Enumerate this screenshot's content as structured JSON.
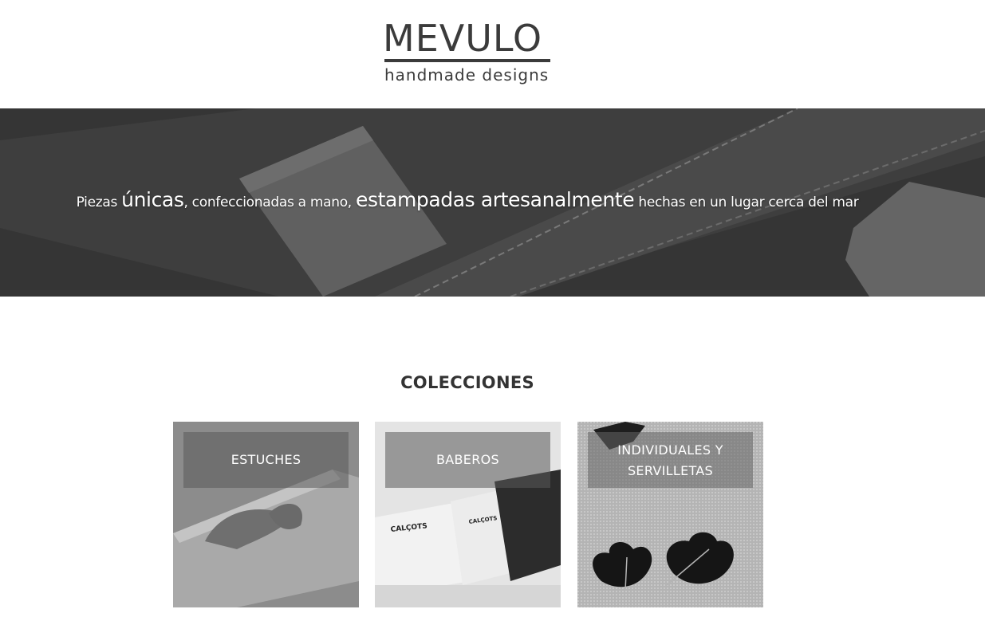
{
  "header": {
    "logo_word": "MEVULO",
    "logo_sub": "handmade  designs"
  },
  "hero": {
    "part1": "Piezas ",
    "part2": "únicas",
    "part3": ", confeccionadas a mano, ",
    "part4": "estampadas artesanalmente",
    "part5": " hechas en un lugar cerca del mar"
  },
  "collections": {
    "title": "COLECCIONES",
    "items": [
      {
        "label": "ESTUCHES"
      },
      {
        "label": "BABEROS"
      },
      {
        "label": "INDIVIDUALES Y SERVILLETAS"
      }
    ],
    "bib_print": "CALÇOTS"
  },
  "colors": {
    "text": "#333333",
    "hero_bg": "#3c3c3c",
    "label_overlay": "rgba(90,90,90,0.55)"
  }
}
